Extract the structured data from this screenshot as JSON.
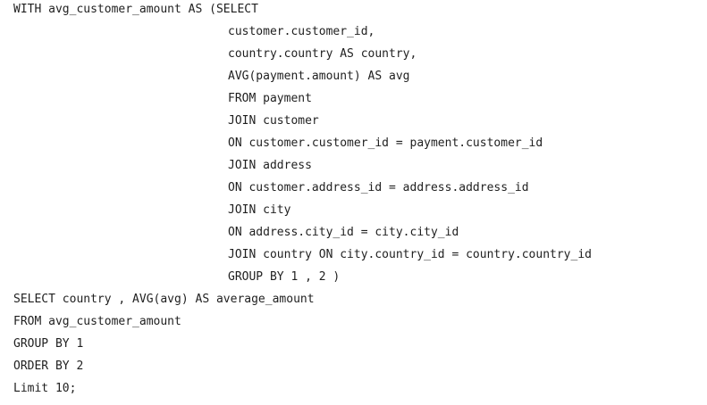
{
  "code": {
    "lines": [
      "WITH avg_customer_amount AS (SELECT",
      "customer.customer_id,",
      "country.country AS country,",
      "AVG(payment.amount) AS avg",
      "FROM payment",
      "JOIN customer",
      "ON customer.customer_id = payment.customer_id",
      "JOIN address",
      "ON customer.address_id = address.address_id",
      "JOIN city",
      "ON address.city_id = city.city_id",
      "JOIN country ON city.country_id = country.country_id",
      "GROUP BY 1 , 2 )",
      "SELECT country , AVG(avg) AS average_amount",
      "FROM avg_customer_amount",
      "GROUP BY 1",
      "ORDER BY 2",
      "Limit 10;"
    ]
  }
}
